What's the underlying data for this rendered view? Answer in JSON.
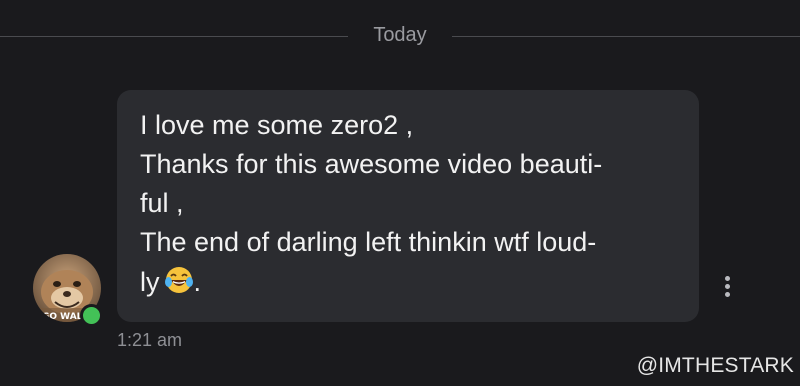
{
  "divider": {
    "label": "Today"
  },
  "message": {
    "lines": [
      "I love me some zero2 ,",
      "Thanks for this awesome video beauti-",
      "ful ,",
      "The end of darling left thinkin wtf loud-",
      "ly"
    ],
    "trailing_text": ".",
    "emoji": "face-with-tears-of-joy",
    "time": "1:21 am"
  },
  "sender": {
    "avatar_caption": "GO WAL",
    "status": "online",
    "status_color": "#43c157"
  },
  "watermark": "@IMTHESTARK"
}
